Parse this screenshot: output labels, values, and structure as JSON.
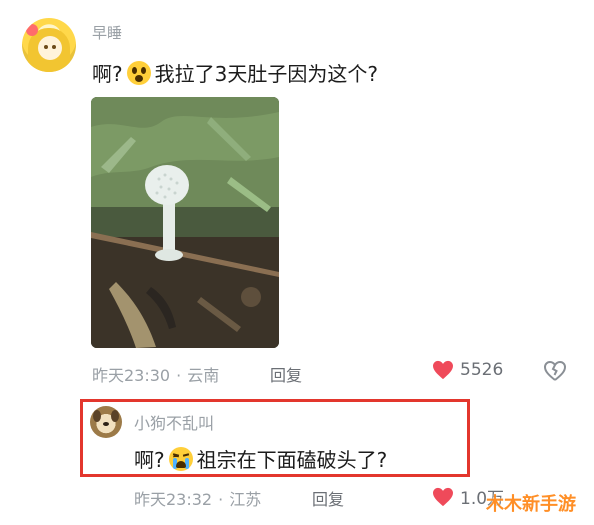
{
  "top_comment": {
    "username": "早睡",
    "text_before_emoji": "啊?",
    "emoji": "shocked-face-emoji",
    "text_after_emoji": "我拉了3天肚子因为这个?",
    "timestamp": "昨天23:30",
    "location": "云南",
    "reply_label": "回复",
    "like_count": "5526"
  },
  "reply_comment": {
    "username": "小狗不乱叫",
    "text_before_emoji": "啊?",
    "emoji": "crying-face-emoji",
    "text_after_emoji": "祖宗在下面磕破头了?",
    "timestamp": "昨天23:32",
    "location": "江苏",
    "reply_label": "回复",
    "like_count": "1.0万"
  },
  "colors": {
    "like_heart": "#ef4a5a",
    "highlight_border": "#e3362d",
    "meta_gray": "#9aa0a6"
  },
  "watermark": "木木新手游"
}
